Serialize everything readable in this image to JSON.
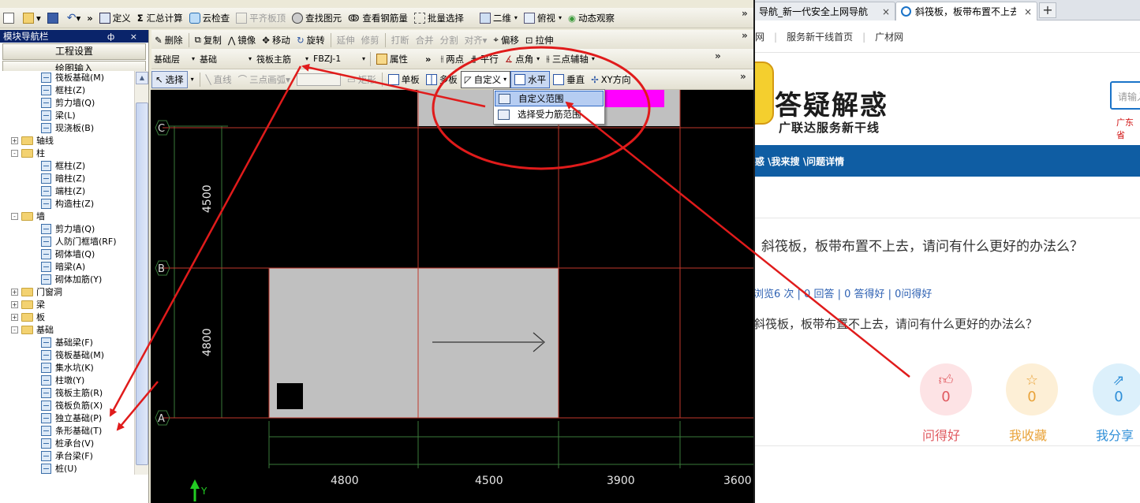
{
  "toolbar1": {
    "items": [
      "定义",
      "汇总计算",
      "云检查",
      "平齐板顶",
      "查找图元",
      "查看钢筋量",
      "批量选择",
      "二维",
      "俯视",
      "动态观察"
    ]
  },
  "toolbar2": {
    "items": [
      "删除",
      "复制",
      "镜像",
      "移动",
      "旋转",
      "延伸",
      "修剪",
      "打断",
      "合并",
      "分割",
      "对齐",
      "偏移",
      "拉伸"
    ]
  },
  "toolbar3": {
    "layer": "基础层",
    "category": "基础",
    "type": "筏板主筋",
    "name": "FBZJ-1",
    "property": "属性",
    "items": [
      "两点",
      "平行",
      "点角",
      "三点辅轴"
    ]
  },
  "toolbar4": {
    "items": [
      "选择",
      "直线",
      "三点画弧",
      "矩形",
      "单板",
      "多板",
      "自定义",
      "水平",
      "垂直",
      "XY方向"
    ]
  },
  "nav": {
    "title": "模块导航栏",
    "ctrl": "ф ×",
    "tab_project": "工程设置",
    "tab_draw": "绘图输入",
    "tools": "+ -",
    "tree": [
      {
        "label": "筏板基础(M)",
        "level": 2
      },
      {
        "label": "框柱(Z)",
        "level": 2
      },
      {
        "label": "剪力墙(Q)",
        "level": 2
      },
      {
        "label": "梁(L)",
        "level": 2
      },
      {
        "label": "现浇板(B)",
        "level": 2
      },
      {
        "label": "轴线",
        "level": 1,
        "exp": "+"
      },
      {
        "label": "柱",
        "level": 1,
        "exp": "-"
      },
      {
        "label": "框柱(Z)",
        "level": 2
      },
      {
        "label": "暗柱(Z)",
        "level": 2
      },
      {
        "label": "端柱(Z)",
        "level": 2
      },
      {
        "label": "构造柱(Z)",
        "level": 2
      },
      {
        "label": "墙",
        "level": 1,
        "exp": "-"
      },
      {
        "label": "剪力墙(Q)",
        "level": 2
      },
      {
        "label": "人防门框墙(RF)",
        "level": 2
      },
      {
        "label": "砌体墙(Q)",
        "level": 2
      },
      {
        "label": "暗梁(A)",
        "level": 2
      },
      {
        "label": "砌体加筋(Y)",
        "level": 2
      },
      {
        "label": "门窗洞",
        "level": 1,
        "exp": "+"
      },
      {
        "label": "梁",
        "level": 1,
        "exp": "+"
      },
      {
        "label": "板",
        "level": 1,
        "exp": "+"
      },
      {
        "label": "基础",
        "level": 1,
        "exp": "-"
      },
      {
        "label": "基础梁(F)",
        "level": 2
      },
      {
        "label": "筏板基础(M)",
        "level": 2
      },
      {
        "label": "集水坑(K)",
        "level": 2
      },
      {
        "label": "柱墩(Y)",
        "level": 2
      },
      {
        "label": "筏板主筋(R)",
        "level": 2
      },
      {
        "label": "筏板负筋(X)",
        "level": 2
      },
      {
        "label": "独立基础(P)",
        "level": 2
      },
      {
        "label": "条形基础(T)",
        "level": 2
      },
      {
        "label": "桩承台(V)",
        "level": 2
      },
      {
        "label": "承台梁(F)",
        "level": 2
      },
      {
        "label": "桩(U)",
        "level": 2
      }
    ]
  },
  "menu": {
    "items": [
      "自定义范围",
      "选择受力筋范围"
    ]
  },
  "canvas": {
    "axis_c": "C",
    "axis_b": "B",
    "axis_a": "A",
    "dim_top": "4500",
    "dim_mid": "4800",
    "dims_bottom": [
      "4800",
      "4500",
      "3900",
      "3600"
    ],
    "y_label": "Y"
  },
  "browser": {
    "tab1": "导航_新一代安全上网导航",
    "tab2": "斜筏板，板带布置不上去，请问有",
    "tab_close": "×",
    "new_tab": "+",
    "fav": [
      "网",
      "服务新干线首页",
      "广材网"
    ],
    "logo_title": "答疑解惑",
    "logo_sub": "广联达服务新干线",
    "search_placeholder": "请输入",
    "region": "广东省",
    "breadcrumb": "惑 \\我来搜 \\问题详情",
    "question_title": "斜筏板，板带布置不上去，请问有什么更好的办法么？",
    "question_stats": "浏览6 次 | 0 回答 | 0 答得好 | 0问得好",
    "question_body": "斜筏板，板带布置不上去，请问有什么更好的办法么？",
    "actions": [
      {
        "label": "问得好",
        "count": "0",
        "color": "#e0595f",
        "bg": "#fde3e5"
      },
      {
        "label": "我收藏",
        "count": "0",
        "color": "#e9a33a",
        "bg": "#fdefd6"
      },
      {
        "label": "我分享",
        "count": "0",
        "color": "#2f8fd8",
        "bg": "#dcf0fb"
      }
    ]
  },
  "colors": {
    "annotation_red": "#e01b1b",
    "grid_red": "#c0392b",
    "slab_gray": "#c0c0c0",
    "magenta": "#ff00ff",
    "green_grid": "#3a7a3a"
  }
}
